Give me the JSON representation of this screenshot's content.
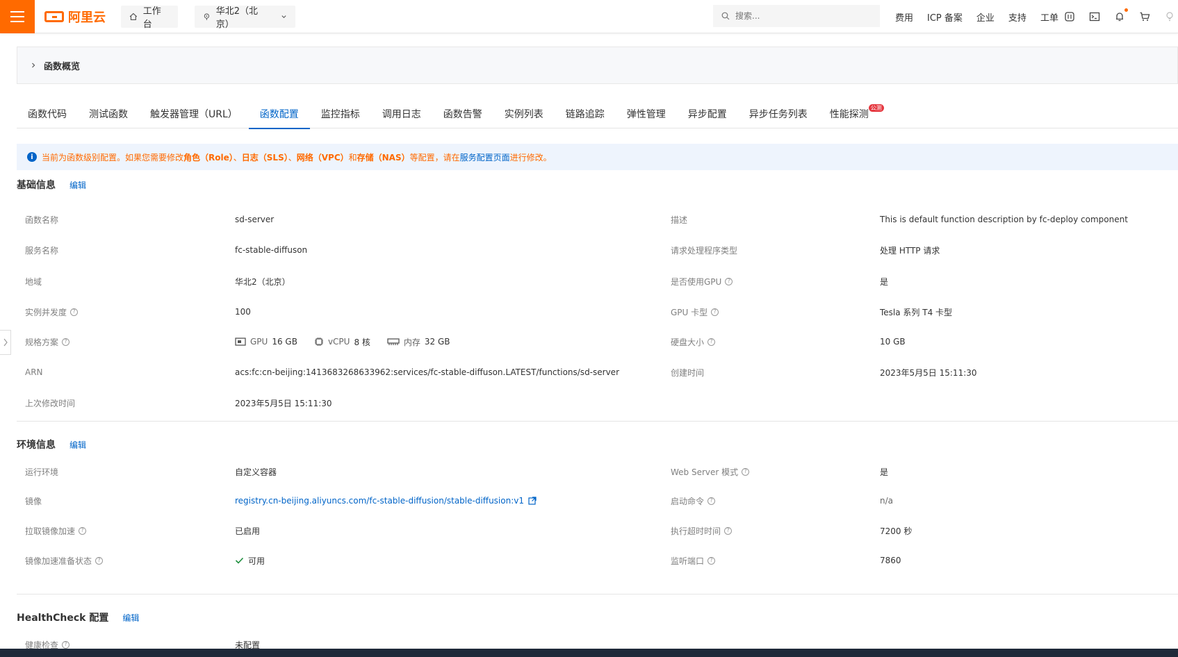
{
  "topbar": {
    "logo_text": "阿里云",
    "workbench": "工作台",
    "region": "华北2（北京）",
    "search_placeholder": "搜索...",
    "links": [
      "费用",
      "ICP 备案",
      "企业",
      "支持",
      "工单"
    ]
  },
  "overview": {
    "label": "函数概览"
  },
  "tabs": [
    {
      "label": "函数代码"
    },
    {
      "label": "测试函数"
    },
    {
      "label": "触发器管理（URL）"
    },
    {
      "label": "函数配置"
    },
    {
      "label": "监控指标"
    },
    {
      "label": "调用日志"
    },
    {
      "label": "函数告警"
    },
    {
      "label": "实例列表"
    },
    {
      "label": "链路追踪"
    },
    {
      "label": "弹性管理"
    },
    {
      "label": "异步配置"
    },
    {
      "label": "异步任务列表"
    },
    {
      "label": "性能探测",
      "badge": "公测"
    }
  ],
  "notice": {
    "p1": "当前为函数级别配置。如果您需要修改",
    "role": "角色（Role）",
    "sep1": "、",
    "log": "日志（SLS）",
    "sep2": "、",
    "net": "网络（VPC）",
    "and": "和",
    "storage": "存储（NAS）",
    "p2": "等配置，请在",
    "link": "服务配置页面",
    "p3": "进行修改。"
  },
  "basic": {
    "title": "基础信息",
    "edit": "编辑",
    "func_name_label": "函数名称",
    "func_name": "sd-server",
    "service_label": "服务名称",
    "service": "fc-stable-diffuson",
    "region_label": "地域",
    "region": "华北2（北京）",
    "concurrency_label": "实例并发度",
    "concurrency": "100",
    "spec_label": "规格方案",
    "gpu_label": "GPU",
    "gpu": "16 GB",
    "vcpu_label": "vCPU",
    "vcpu": "8 核",
    "mem_label": "内存",
    "mem": "32 GB",
    "arn_label": "ARN",
    "arn": "acs:fc:cn-beijing:1413683268633962:services/fc-stable-diffuson.LATEST/functions/sd-server",
    "modified_label": "上次修改时间",
    "modified": "2023年5月5日 15:11:30",
    "desc_label": "描述",
    "desc": "This is default function description by fc-deploy component",
    "handler_label": "请求处理程序类型",
    "handler": "处理 HTTP 请求",
    "use_gpu_label": "是否使用GPU",
    "use_gpu": "是",
    "gpu_type_label": "GPU 卡型",
    "gpu_type": "Tesla 系列 T4 卡型",
    "disk_label": "硬盘大小",
    "disk": "10 GB",
    "created_label": "创建时间",
    "created": "2023年5月5日 15:11:30"
  },
  "env": {
    "title": "环境信息",
    "edit": "编辑",
    "runtime_label": "运行环境",
    "runtime": "自定义容器",
    "image_label": "镜像",
    "image": "registry.cn-beijing.aliyuncs.com/fc-stable-diffusion/stable-diffusion:v1",
    "accel_label": "拉取镜像加速",
    "accel": "已启用",
    "accel_status_label": "镜像加速准备状态",
    "accel_status": "可用",
    "webserver_label": "Web Server 模式",
    "webserver": "是",
    "cmd_label": "启动命令",
    "cmd": "n/a",
    "timeout_label": "执行超时时间",
    "timeout": "7200 秒",
    "port_label": "监听端口",
    "port": "7860"
  },
  "health": {
    "title": "HealthCheck 配置",
    "edit": "编辑",
    "check_label": "健康检查",
    "check": "未配置"
  },
  "colors": {
    "accent": "#ff6a00",
    "link": "#0064c8"
  }
}
